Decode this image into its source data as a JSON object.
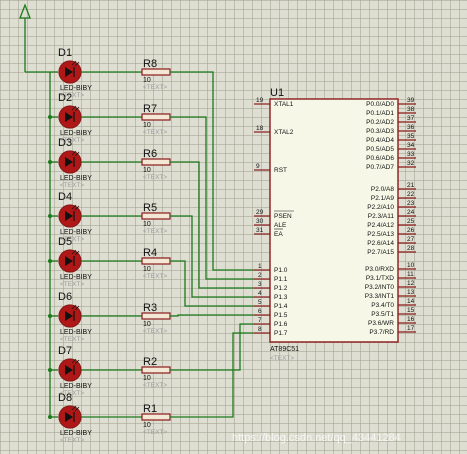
{
  "rows": [
    {
      "led": "D1",
      "res": "R8",
      "value": "10",
      "port": "P1.0",
      "pin": "1"
    },
    {
      "led": "D2",
      "res": "R7",
      "value": "10",
      "port": "P1.1",
      "pin": "2"
    },
    {
      "led": "D3",
      "res": "R6",
      "value": "10",
      "port": "P1.2",
      "pin": "3"
    },
    {
      "led": "D4",
      "res": "R5",
      "value": "10",
      "port": "P1.3",
      "pin": "4"
    },
    {
      "led": "D5",
      "res": "R4",
      "value": "10",
      "port": "P1.4",
      "pin": "5"
    },
    {
      "led": "D6",
      "res": "R3",
      "value": "10",
      "port": "P1.5",
      "pin": "6"
    },
    {
      "led": "D7",
      "res": "R2",
      "value": "10",
      "port": "P1.6",
      "pin": "7"
    },
    {
      "led": "D8",
      "res": "R1",
      "value": "10",
      "port": "P1.7",
      "pin": "8"
    }
  ],
  "led_part": "LED-BIBY",
  "text_placeholder": "<TEXT>",
  "mcu": {
    "ref": "U1",
    "part": "AT89C51",
    "text": "<TEXT>",
    "left_pins": [
      {
        "num": "19",
        "name": "XTAL1"
      },
      {
        "num": "18",
        "name": "XTAL2"
      },
      {
        "num": "9",
        "name": "RST"
      },
      {
        "num": "29",
        "name": "PSEN"
      },
      {
        "num": "30",
        "name": "ALE"
      },
      {
        "num": "31",
        "name": "EA"
      }
    ],
    "right_pins": [
      {
        "num": "39",
        "name": "P0.0/AD0"
      },
      {
        "num": "38",
        "name": "P0.1/AD1"
      },
      {
        "num": "37",
        "name": "P0.2/AD2"
      },
      {
        "num": "36",
        "name": "P0.3/AD3"
      },
      {
        "num": "35",
        "name": "P0.4/AD4"
      },
      {
        "num": "34",
        "name": "P0.5/AD5"
      },
      {
        "num": "33",
        "name": "P0.6/AD6"
      },
      {
        "num": "32",
        "name": "P0.7/AD7"
      },
      {
        "num": "21",
        "name": "P2.0/A8"
      },
      {
        "num": "22",
        "name": "P2.1/A9"
      },
      {
        "num": "23",
        "name": "P2.2/A10"
      },
      {
        "num": "24",
        "name": "P2.3/A11"
      },
      {
        "num": "25",
        "name": "P2.4/A12"
      },
      {
        "num": "26",
        "name": "P2.5/A13"
      },
      {
        "num": "27",
        "name": "P2.6/A14"
      },
      {
        "num": "28",
        "name": "P2.7/A15"
      },
      {
        "num": "10",
        "name": "P3.0/RXD"
      },
      {
        "num": "11",
        "name": "P3.1/TXD"
      },
      {
        "num": "12",
        "name": "P3.2/INT0"
      },
      {
        "num": "13",
        "name": "P3.3/INT1"
      },
      {
        "num": "14",
        "name": "P3.4/T0"
      },
      {
        "num": "15",
        "name": "P3.5/T1"
      },
      {
        "num": "16",
        "name": "P3.6/WR"
      },
      {
        "num": "17",
        "name": "P3.7/RD"
      }
    ]
  },
  "colors": {
    "wire": "#1c7a1c",
    "component": "#8b1a1a",
    "led_fill": "#b01818",
    "grid": "#dedfd2"
  },
  "watermark": "https://blog.csdn.net/qq_43441284"
}
